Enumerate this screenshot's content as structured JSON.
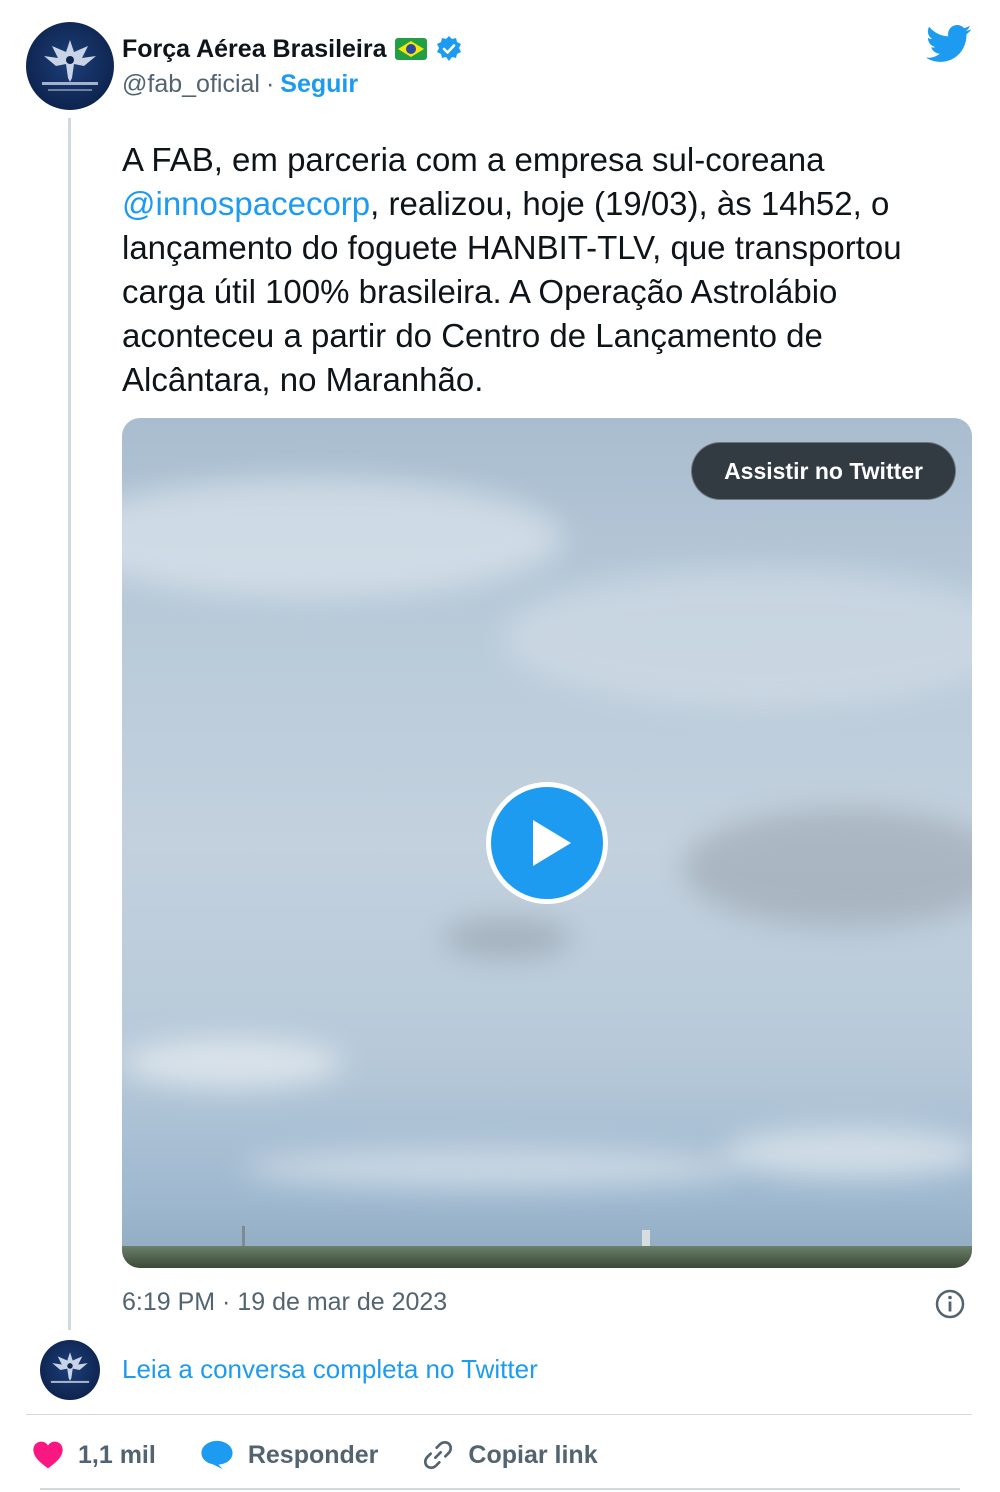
{
  "author": {
    "display_name": "Força Aérea Brasileira",
    "handle": "@fab_oficial",
    "separator": "·",
    "follow_label": "Seguir",
    "avatar_text": "FORÇA AÉREA BRASILEIRA",
    "flag_icon": "brazil-flag-emoji",
    "verified_icon": "verified-badge-icon"
  },
  "tweet": {
    "text_before_mention": "A FAB, em parceria com a empresa sul-coreana",
    "mention": "@innospacecorp",
    "text_after_mention": ", realizou, hoje (19/03), às 14h52, o lançamento do foguete HANBIT-TLV, que transportou carga útil 100% brasileira. A Operação Astrolábio aconteceu a partir do Centro de Lançamento de Alcântara, no Maranhão.",
    "timestamp": "6:19 PM · 19 de mar de 2023"
  },
  "media": {
    "watch_label": "Assistir no Twitter",
    "play_icon": "play-icon"
  },
  "conversation": {
    "read_more_label": "Leia a conversa completa no Twitter"
  },
  "actions": {
    "like_count": "1,1 mil",
    "reply_label": "Responder",
    "copy_link_label": "Copiar link"
  },
  "colors": {
    "accent": "#1d9bf0",
    "text": "#0f1419",
    "muted": "#536471",
    "like": "#f91880"
  }
}
